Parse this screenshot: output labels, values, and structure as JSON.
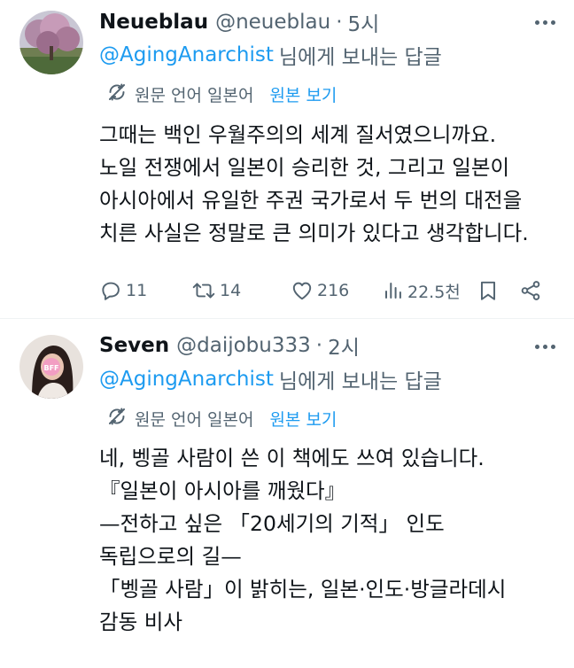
{
  "tweets": [
    {
      "display_name": "Neueblau",
      "handle": "@neueblau",
      "separator": "·",
      "time": "5시",
      "reply_to_mention": "@AgingAnarchist",
      "reply_to_suffix": "님에게 보내는 답글",
      "translate_label": "원문 언어 일본어",
      "translate_link": "원본 보기",
      "body_lines": [
        "그때는 백인 우월주의의 세계 질서였으니까요.",
        "노일 전쟁에서 일본이 승리한 것, 그리고 일본이",
        "아시아에서 유일한 주권 국가로서 두 번의 대전을",
        "치른 사실은 정말로 큰 의미가 있다고 생각합니다."
      ],
      "stats": {
        "replies": "11",
        "retweets": "14",
        "likes": "216",
        "views": "22.5천"
      }
    },
    {
      "display_name": "Seven",
      "handle": "@daijobu333",
      "separator": "·",
      "time": "2시",
      "avatar_sticker": "BFF",
      "reply_to_mention": "@AgingAnarchist",
      "reply_to_suffix": "님에게 보내는 답글",
      "translate_label": "원문 언어 일본어",
      "translate_link": "원본 보기",
      "body_lines": [
        "네, 벵골 사람이 쓴 이 책에도 쓰여 있습니다.",
        "『일본이 아시아를 깨웠다』",
        "—전하고 싶은 「20세기의 기적」 인도",
        "독립으로의 길—",
        "「벵골 사람」이 밝히는, 일본·인도·방글라데시",
        "감동 비사"
      ]
    }
  ],
  "colors": {
    "text": "#0f1419",
    "secondary": "#536471",
    "accent": "#1d9bf0",
    "divider": "#eff3f4"
  },
  "icons": {
    "more": "more-dots-icon",
    "translate": "translate-icon",
    "reply": "reply-icon",
    "retweet": "retweet-icon",
    "like": "heart-icon",
    "views": "views-icon",
    "bookmark": "bookmark-icon",
    "share": "share-icon"
  }
}
